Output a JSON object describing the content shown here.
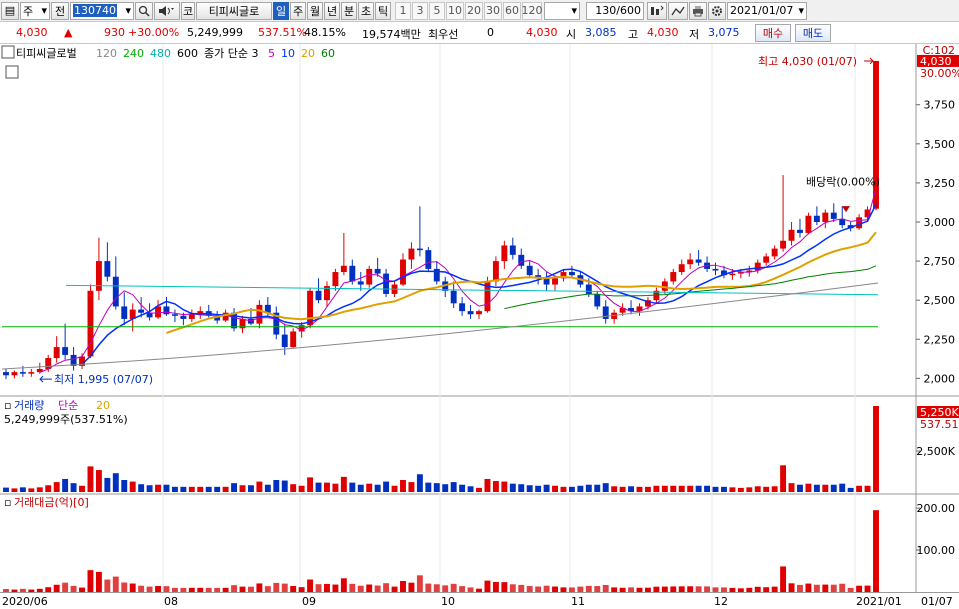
{
  "toolbar": {
    "menu_glyph": "▤",
    "mode": "주",
    "period_prefix": "전",
    "stock_code": "130740",
    "search_icon": "search-icon",
    "sound_icon": "speaker-icon",
    "market_badge": "코",
    "stock_name": "티피씨글로",
    "periods": [
      "일",
      "주",
      "월",
      "년",
      "분",
      "초",
      "틱"
    ],
    "active_period": "일",
    "intervals": [
      "1",
      "3",
      "5",
      "10",
      "20",
      "30",
      "60",
      "120"
    ],
    "count": "130/600",
    "date": "2021/01/07"
  },
  "info": {
    "price": "4,030",
    "change": "930",
    "change_pct": "+30.00%",
    "volume": "5,249,999",
    "volume_ratio": "537.51%",
    "turnover": "48.15%",
    "amount": "19,574백만",
    "pref_label": "최우선",
    "pref_value": "0",
    "pref_price": "4,030",
    "open_label": "시",
    "open": "3,085",
    "high_label": "고",
    "high": "4,030",
    "low_label": "저",
    "low": "3,075",
    "buy_label": "매수",
    "sell_label": "매도"
  },
  "legend": {
    "name": "티피씨글로벌",
    "ma_long": [
      "120",
      "240",
      "480",
      "600"
    ],
    "ma_long_colors": [
      "#888888",
      "#00b000",
      "#00b0b0",
      "#000000"
    ],
    "ma_prefix": "종가 단순 3",
    "ma_short": [
      "5",
      "10",
      "20",
      "60"
    ],
    "ma_short_colors": [
      "#c000c0",
      "#0030ff",
      "#e0a000",
      "#008000"
    ],
    "volume_title": "거래량",
    "volume_type": "단순",
    "volume_ma": "20",
    "volume_value": "5,249,999주(537.51%)",
    "amount_title": "거래대금(억)[0]"
  },
  "annotations": {
    "high": "최고 4,030 (01/07)",
    "low": "최저 1,995 (07/07)",
    "dividend": "배당락(0.00%)"
  },
  "price_axis": {
    "top_label": "C:102",
    "current": "4,030",
    "current_pct": "30.00%",
    "ticks": [
      "3,750",
      "3,500",
      "3,250",
      "3,000",
      "2,750",
      "2,500",
      "2,250",
      "2,000"
    ],
    "tick_values": [
      3750,
      3500,
      3250,
      3000,
      2750,
      2500,
      2250,
      2000
    ]
  },
  "volume_axis": {
    "current": "5,250K",
    "current_pct": "537.51%",
    "ticks": [
      "2,500K"
    ]
  },
  "amount_axis": {
    "ticks": [
      "200.00",
      "100.00"
    ]
  },
  "xaxis": {
    "labels": [
      "2020/06",
      "08",
      "09",
      "10",
      "11",
      "12",
      "2021/01",
      "01/07"
    ]
  },
  "colors": {
    "up": "#e00000",
    "down": "#0030c0",
    "grid": "#c8c8c8"
  },
  "chart_data": {
    "type": "candlestick",
    "ylim": [
      1900,
      4100
    ],
    "series": [
      {
        "name": "price",
        "values": [
          [
            2040,
            2060,
            1995,
            2020
          ],
          [
            2020,
            2050,
            2000,
            2040
          ],
          [
            2040,
            2080,
            2010,
            2030
          ],
          [
            2030,
            2060,
            2010,
            2040
          ],
          [
            2040,
            2100,
            2030,
            2060
          ],
          [
            2060,
            2150,
            2040,
            2130
          ],
          [
            2130,
            2270,
            2100,
            2200
          ],
          [
            2200,
            2350,
            2120,
            2150
          ],
          [
            2150,
            2200,
            2050,
            2080
          ],
          [
            2080,
            2160,
            2060,
            2140
          ],
          [
            2140,
            2600,
            2130,
            2560
          ],
          [
            2560,
            2900,
            2500,
            2750
          ],
          [
            2750,
            2870,
            2620,
            2650
          ],
          [
            2650,
            2780,
            2440,
            2460
          ],
          [
            2460,
            2550,
            2340,
            2380
          ],
          [
            2380,
            2480,
            2300,
            2440
          ],
          [
            2440,
            2520,
            2390,
            2420
          ],
          [
            2420,
            2480,
            2370,
            2390
          ],
          [
            2390,
            2500,
            2380,
            2460
          ],
          [
            2460,
            2520,
            2400,
            2410
          ],
          [
            2410,
            2440,
            2360,
            2400
          ],
          [
            2400,
            2420,
            2340,
            2380
          ],
          [
            2380,
            2440,
            2360,
            2410
          ],
          [
            2410,
            2460,
            2380,
            2430
          ],
          [
            2430,
            2470,
            2390,
            2400
          ],
          [
            2400,
            2430,
            2350,
            2370
          ],
          [
            2370,
            2440,
            2360,
            2420
          ],
          [
            2420,
            2450,
            2300,
            2320
          ],
          [
            2320,
            2400,
            2290,
            2380
          ],
          [
            2380,
            2450,
            2340,
            2350
          ],
          [
            2350,
            2500,
            2320,
            2470
          ],
          [
            2470,
            2520,
            2400,
            2420
          ],
          [
            2420,
            2460,
            2250,
            2280
          ],
          [
            2280,
            2350,
            2150,
            2200
          ],
          [
            2200,
            2320,
            2190,
            2300
          ],
          [
            2300,
            2360,
            2260,
            2340
          ],
          [
            2340,
            2580,
            2320,
            2560
          ],
          [
            2560,
            2640,
            2480,
            2500
          ],
          [
            2500,
            2620,
            2460,
            2590
          ],
          [
            2590,
            2700,
            2560,
            2680
          ],
          [
            2680,
            2930,
            2660,
            2720
          ],
          [
            2720,
            2760,
            2600,
            2620
          ],
          [
            2620,
            2680,
            2560,
            2600
          ],
          [
            2600,
            2720,
            2580,
            2700
          ],
          [
            2700,
            2770,
            2650,
            2670
          ],
          [
            2670,
            2700,
            2520,
            2540
          ],
          [
            2540,
            2620,
            2520,
            2600
          ],
          [
            2600,
            2800,
            2590,
            2760
          ],
          [
            2760,
            2870,
            2700,
            2830
          ],
          [
            2830,
            3100,
            2780,
            2820
          ],
          [
            2820,
            2840,
            2680,
            2700
          ],
          [
            2700,
            2750,
            2600,
            2620
          ],
          [
            2620,
            2650,
            2520,
            2560
          ],
          [
            2560,
            2620,
            2450,
            2480
          ],
          [
            2480,
            2520,
            2400,
            2430
          ],
          [
            2430,
            2470,
            2380,
            2410
          ],
          [
            2410,
            2440,
            2380,
            2430
          ],
          [
            2430,
            2650,
            2420,
            2620
          ],
          [
            2620,
            2780,
            2590,
            2750
          ],
          [
            2750,
            2880,
            2700,
            2850
          ],
          [
            2850,
            2900,
            2760,
            2790
          ],
          [
            2790,
            2830,
            2700,
            2720
          ],
          [
            2720,
            2750,
            2640,
            2660
          ],
          [
            2660,
            2700,
            2600,
            2640
          ],
          [
            2640,
            2680,
            2560,
            2600
          ],
          [
            2600,
            2660,
            2560,
            2640
          ],
          [
            2640,
            2700,
            2620,
            2680
          ],
          [
            2680,
            2720,
            2640,
            2660
          ],
          [
            2660,
            2680,
            2580,
            2600
          ],
          [
            2600,
            2640,
            2520,
            2540
          ],
          [
            2540,
            2560,
            2440,
            2460
          ],
          [
            2460,
            2500,
            2350,
            2380
          ],
          [
            2380,
            2440,
            2350,
            2420
          ],
          [
            2420,
            2480,
            2400,
            2450
          ],
          [
            2450,
            2500,
            2410,
            2430
          ],
          [
            2430,
            2480,
            2400,
            2460
          ],
          [
            2460,
            2520,
            2440,
            2500
          ],
          [
            2500,
            2580,
            2480,
            2560
          ],
          [
            2560,
            2640,
            2540,
            2620
          ],
          [
            2620,
            2700,
            2600,
            2680
          ],
          [
            2680,
            2760,
            2660,
            2730
          ],
          [
            2730,
            2800,
            2700,
            2760
          ],
          [
            2760,
            2820,
            2720,
            2740
          ],
          [
            2740,
            2780,
            2680,
            2700
          ],
          [
            2700,
            2740,
            2660,
            2690
          ],
          [
            2690,
            2720,
            2640,
            2660
          ],
          [
            2660,
            2700,
            2630,
            2670
          ],
          [
            2670,
            2700,
            2640,
            2680
          ],
          [
            2680,
            2720,
            2650,
            2690
          ],
          [
            2690,
            2760,
            2670,
            2740
          ],
          [
            2740,
            2800,
            2720,
            2780
          ],
          [
            2780,
            2850,
            2760,
            2830
          ],
          [
            2830,
            3300,
            2810,
            2880
          ],
          [
            2880,
            3000,
            2850,
            2950
          ],
          [
            2950,
            3020,
            2900,
            2930
          ],
          [
            2930,
            3060,
            2920,
            3040
          ],
          [
            3040,
            3100,
            2980,
            3000
          ],
          [
            3000,
            3080,
            2960,
            3060
          ],
          [
            3060,
            3120,
            3000,
            3020
          ],
          [
            3020,
            3100,
            2960,
            2980
          ],
          [
            2980,
            3000,
            2940,
            2960
          ],
          [
            2960,
            3050,
            2950,
            3030
          ],
          [
            3030,
            3100,
            3000,
            3080
          ],
          [
            3085,
            4030,
            3075,
            4030
          ]
        ]
      }
    ]
  }
}
